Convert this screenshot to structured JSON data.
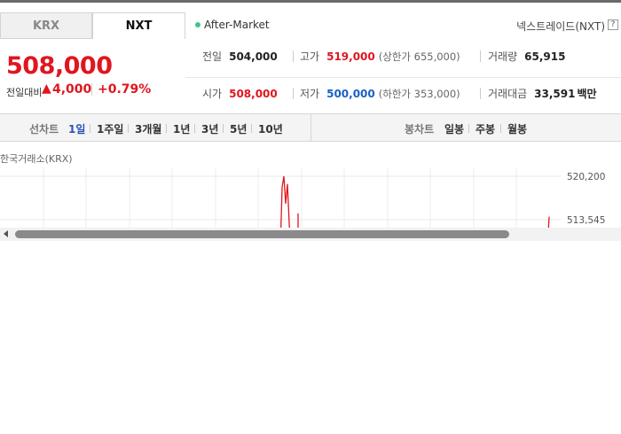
{
  "tabs": [
    {
      "label": "KRX",
      "active": false
    },
    {
      "label": "NXT",
      "active": true
    }
  ],
  "session_status": "After-Market",
  "market_name": "넥스트레이드(NXT)",
  "help_icon": "?",
  "price": {
    "current": "508,000",
    "change_label": "전일대비",
    "change_arrow": "▲",
    "change_value": "4,000",
    "change_pct": "+0.79%",
    "color": "#e0161e"
  },
  "stats": {
    "prev_close": {
      "label": "전일",
      "value": "504,000"
    },
    "high": {
      "label": "고가",
      "value": "519,000",
      "sub": "(상한가 655,000)"
    },
    "volume": {
      "label": "거래량",
      "value": "65,915"
    },
    "open": {
      "label": "시가",
      "value": "508,000"
    },
    "low": {
      "label": "저가",
      "value": "500,000",
      "sub": "(하한가 353,000)"
    },
    "amount": {
      "label": "거래대금",
      "value": "33,591",
      "unit": "백만"
    }
  },
  "line_chart_bar": {
    "label": "선차트",
    "periods": [
      "1일",
      "1주일",
      "3개월",
      "1년",
      "3년",
      "5년",
      "10년"
    ],
    "active": "1일"
  },
  "candle_chart_bar": {
    "label": "봉차트",
    "periods": [
      "일봉",
      "주봉",
      "월봉"
    ]
  },
  "chart": {
    "exchange_label": "한국거래소(KRX)",
    "y_ticks": [
      "520,200",
      "513,545"
    ],
    "accent": "#e0161e"
  },
  "chart_data": {
    "type": "line",
    "title": "",
    "ylabel": "",
    "xlabel": "",
    "y_ticks": [
      520200,
      513545
    ],
    "ylim": [
      511000,
      522000
    ],
    "series": [
      {
        "values": [
          509000,
          518500,
          520200,
          516000,
          519000,
          510000,
          509000
        ]
      },
      {
        "values": [
          509000,
          514000
        ]
      }
    ],
    "grid": true
  }
}
